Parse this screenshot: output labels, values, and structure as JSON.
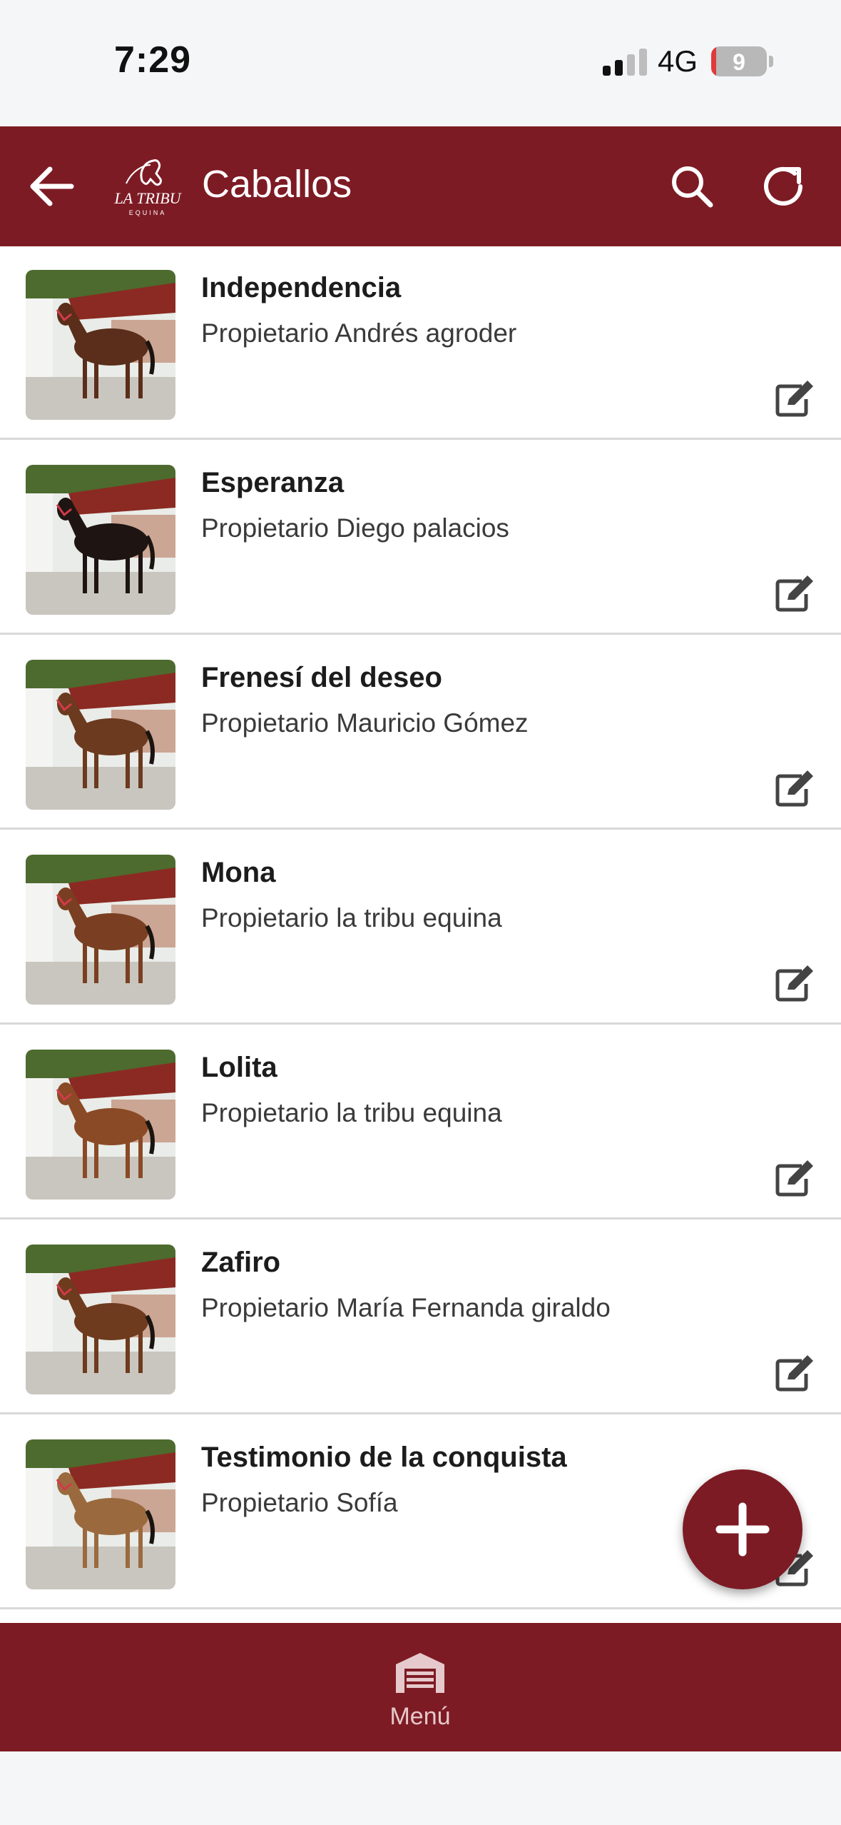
{
  "status_bar": {
    "time": "7:29",
    "network": "4G",
    "battery": "9",
    "battery_level": 0.09
  },
  "header": {
    "title": "Caballos",
    "logo_text": "LA TRIBU EQUINA"
  },
  "horses": [
    {
      "name": "Independencia",
      "owner": "Propietario Andrés agroder",
      "coat": "#5a2e1a"
    },
    {
      "name": "Esperanza",
      "owner": "Propietario Diego palacios",
      "coat": "#1e1512"
    },
    {
      "name": "Frenesí del deseo",
      "owner": "Propietario Mauricio Gómez",
      "coat": "#6b3a1f"
    },
    {
      "name": "Mona",
      "owner": "Propietario la tribu equina",
      "coat": "#7a3f22"
    },
    {
      "name": "Lolita",
      "owner": "Propietario la tribu equina",
      "coat": "#8a4a26"
    },
    {
      "name": "Zafiro",
      "owner": "Propietario María Fernanda giraldo",
      "coat": "#6e3b1e"
    },
    {
      "name": "Testimonio de la conquista",
      "owner": "Propietario Sofía",
      "coat": "#9a6a3e"
    }
  ],
  "bottom_nav": {
    "menu_label": "Menú"
  },
  "colors": {
    "primary": "#7d1b24",
    "divider": "#d9d9d9",
    "icon_gray": "#444444"
  }
}
